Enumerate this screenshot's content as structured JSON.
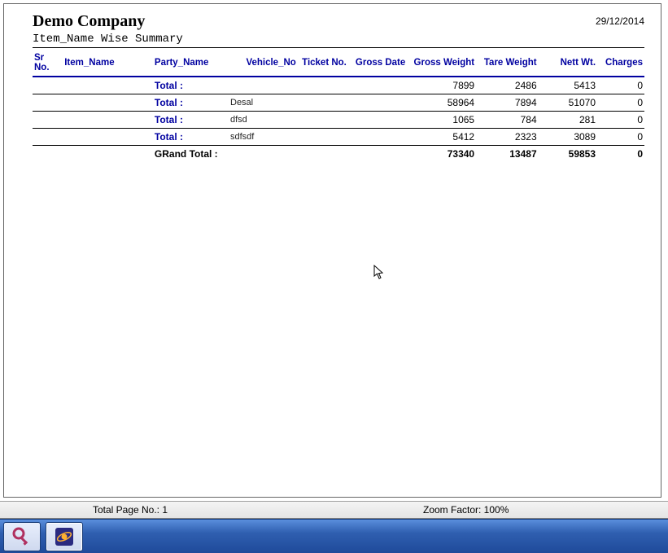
{
  "header": {
    "company": "Demo Company",
    "date": "29/12/2014",
    "subtitle": "Item_Name Wise Summary"
  },
  "columns": {
    "srno": "Sr No.",
    "item": "Item_Name",
    "party": "Party_Name",
    "vehicle": "Vehicle_No",
    "ticket": "Ticket No.",
    "grossdate": "Gross Date",
    "gw": "Gross Weight",
    "tw": "Tare Weight",
    "nw": "Nett Wt.",
    "chg": "Charges"
  },
  "rows": [
    {
      "label": "Total :",
      "vehicle": "",
      "gw": "7899",
      "tw": "2486",
      "nw": "5413",
      "chg": "0"
    },
    {
      "label": "Total :",
      "vehicle": "Desal",
      "gw": "58964",
      "tw": "7894",
      "nw": "51070",
      "chg": "0"
    },
    {
      "label": "Total :",
      "vehicle": "dfsd",
      "gw": "1065",
      "tw": "784",
      "nw": "281",
      "chg": "0"
    },
    {
      "label": "Total :",
      "vehicle": "sdfsdf",
      "gw": "5412",
      "tw": "2323",
      "nw": "3089",
      "chg": "0"
    }
  ],
  "grand": {
    "label": "GRand Total :",
    "gw": "73340",
    "tw": "13487",
    "nw": "59853",
    "chg": "0"
  },
  "status": {
    "pages": "Total Page No.: 1",
    "zoom": "Zoom Factor: 100%"
  },
  "taskbar": {
    "app1": "access-app",
    "app2": "browser-app"
  }
}
